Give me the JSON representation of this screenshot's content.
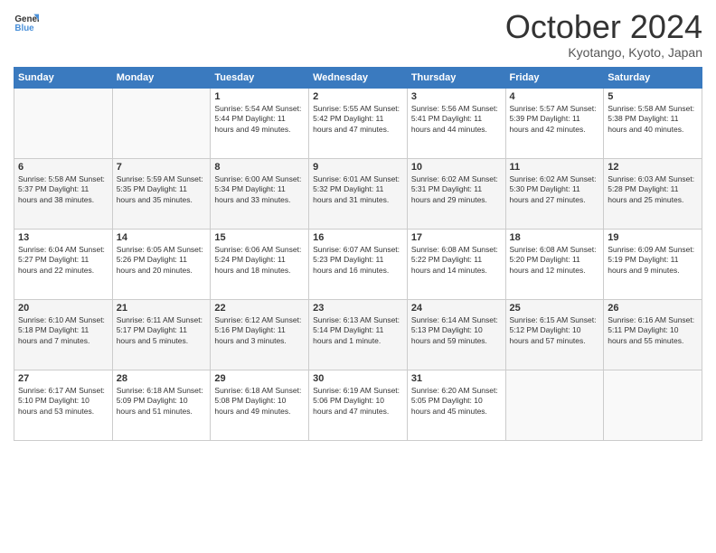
{
  "logo": {
    "line1": "General",
    "line2": "Blue"
  },
  "title": "October 2024",
  "subtitle": "Kyotango, Kyoto, Japan",
  "weekdays": [
    "Sunday",
    "Monday",
    "Tuesday",
    "Wednesday",
    "Thursday",
    "Friday",
    "Saturday"
  ],
  "weeks": [
    [
      {
        "day": "",
        "info": ""
      },
      {
        "day": "",
        "info": ""
      },
      {
        "day": "1",
        "info": "Sunrise: 5:54 AM\nSunset: 5:44 PM\nDaylight: 11 hours\nand 49 minutes."
      },
      {
        "day": "2",
        "info": "Sunrise: 5:55 AM\nSunset: 5:42 PM\nDaylight: 11 hours\nand 47 minutes."
      },
      {
        "day": "3",
        "info": "Sunrise: 5:56 AM\nSunset: 5:41 PM\nDaylight: 11 hours\nand 44 minutes."
      },
      {
        "day": "4",
        "info": "Sunrise: 5:57 AM\nSunset: 5:39 PM\nDaylight: 11 hours\nand 42 minutes."
      },
      {
        "day": "5",
        "info": "Sunrise: 5:58 AM\nSunset: 5:38 PM\nDaylight: 11 hours\nand 40 minutes."
      }
    ],
    [
      {
        "day": "6",
        "info": "Sunrise: 5:58 AM\nSunset: 5:37 PM\nDaylight: 11 hours\nand 38 minutes."
      },
      {
        "day": "7",
        "info": "Sunrise: 5:59 AM\nSunset: 5:35 PM\nDaylight: 11 hours\nand 35 minutes."
      },
      {
        "day": "8",
        "info": "Sunrise: 6:00 AM\nSunset: 5:34 PM\nDaylight: 11 hours\nand 33 minutes."
      },
      {
        "day": "9",
        "info": "Sunrise: 6:01 AM\nSunset: 5:32 PM\nDaylight: 11 hours\nand 31 minutes."
      },
      {
        "day": "10",
        "info": "Sunrise: 6:02 AM\nSunset: 5:31 PM\nDaylight: 11 hours\nand 29 minutes."
      },
      {
        "day": "11",
        "info": "Sunrise: 6:02 AM\nSunset: 5:30 PM\nDaylight: 11 hours\nand 27 minutes."
      },
      {
        "day": "12",
        "info": "Sunrise: 6:03 AM\nSunset: 5:28 PM\nDaylight: 11 hours\nand 25 minutes."
      }
    ],
    [
      {
        "day": "13",
        "info": "Sunrise: 6:04 AM\nSunset: 5:27 PM\nDaylight: 11 hours\nand 22 minutes."
      },
      {
        "day": "14",
        "info": "Sunrise: 6:05 AM\nSunset: 5:26 PM\nDaylight: 11 hours\nand 20 minutes."
      },
      {
        "day": "15",
        "info": "Sunrise: 6:06 AM\nSunset: 5:24 PM\nDaylight: 11 hours\nand 18 minutes."
      },
      {
        "day": "16",
        "info": "Sunrise: 6:07 AM\nSunset: 5:23 PM\nDaylight: 11 hours\nand 16 minutes."
      },
      {
        "day": "17",
        "info": "Sunrise: 6:08 AM\nSunset: 5:22 PM\nDaylight: 11 hours\nand 14 minutes."
      },
      {
        "day": "18",
        "info": "Sunrise: 6:08 AM\nSunset: 5:20 PM\nDaylight: 11 hours\nand 12 minutes."
      },
      {
        "day": "19",
        "info": "Sunrise: 6:09 AM\nSunset: 5:19 PM\nDaylight: 11 hours\nand 9 minutes."
      }
    ],
    [
      {
        "day": "20",
        "info": "Sunrise: 6:10 AM\nSunset: 5:18 PM\nDaylight: 11 hours\nand 7 minutes."
      },
      {
        "day": "21",
        "info": "Sunrise: 6:11 AM\nSunset: 5:17 PM\nDaylight: 11 hours\nand 5 minutes."
      },
      {
        "day": "22",
        "info": "Sunrise: 6:12 AM\nSunset: 5:16 PM\nDaylight: 11 hours\nand 3 minutes."
      },
      {
        "day": "23",
        "info": "Sunrise: 6:13 AM\nSunset: 5:14 PM\nDaylight: 11 hours\nand 1 minute."
      },
      {
        "day": "24",
        "info": "Sunrise: 6:14 AM\nSunset: 5:13 PM\nDaylight: 10 hours\nand 59 minutes."
      },
      {
        "day": "25",
        "info": "Sunrise: 6:15 AM\nSunset: 5:12 PM\nDaylight: 10 hours\nand 57 minutes."
      },
      {
        "day": "26",
        "info": "Sunrise: 6:16 AM\nSunset: 5:11 PM\nDaylight: 10 hours\nand 55 minutes."
      }
    ],
    [
      {
        "day": "27",
        "info": "Sunrise: 6:17 AM\nSunset: 5:10 PM\nDaylight: 10 hours\nand 53 minutes."
      },
      {
        "day": "28",
        "info": "Sunrise: 6:18 AM\nSunset: 5:09 PM\nDaylight: 10 hours\nand 51 minutes."
      },
      {
        "day": "29",
        "info": "Sunrise: 6:18 AM\nSunset: 5:08 PM\nDaylight: 10 hours\nand 49 minutes."
      },
      {
        "day": "30",
        "info": "Sunrise: 6:19 AM\nSunset: 5:06 PM\nDaylight: 10 hours\nand 47 minutes."
      },
      {
        "day": "31",
        "info": "Sunrise: 6:20 AM\nSunset: 5:05 PM\nDaylight: 10 hours\nand 45 minutes."
      },
      {
        "day": "",
        "info": ""
      },
      {
        "day": "",
        "info": ""
      }
    ]
  ]
}
